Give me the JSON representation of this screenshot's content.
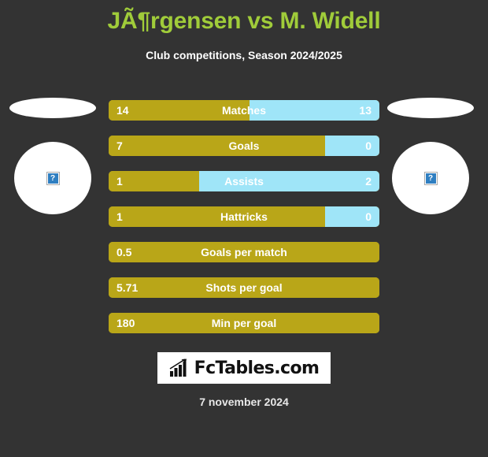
{
  "header": {
    "title": "JÃ¶rgensen vs M. Widell",
    "subtitle": "Club competitions, Season 2024/2025"
  },
  "players": {
    "left": {
      "avatar_icon": "broken-image-icon",
      "placeholder_glyph": "?"
    },
    "right": {
      "avatar_icon": "broken-image-icon",
      "placeholder_glyph": "?"
    }
  },
  "colors": {
    "background": "#333333",
    "title": "#a0cc3a",
    "home_bar": "#b9a618",
    "away_bar": "#9fe5f8",
    "text": "#ffffff"
  },
  "footer": {
    "logo_text": "FcTables.com",
    "logo_icon": "bar-chart-icon",
    "date": "7 november 2024"
  },
  "chart_data": {
    "type": "bar",
    "title": "JÃ¶rgensen vs M. Widell",
    "subtitle": "Club competitions, Season 2024/2025",
    "orientation": "horizontal-diverging",
    "series": [
      {
        "name": "JÃ¶rgensen",
        "color": "#b9a618"
      },
      {
        "name": "M. Widell",
        "color": "#9fe5f8"
      }
    ],
    "categories": [
      "Matches",
      "Goals",
      "Assists",
      "Hattricks",
      "Goals per match",
      "Shots per goal",
      "Min per goal"
    ],
    "rows": [
      {
        "label": "Matches",
        "left_value": "14",
        "right_value": "13",
        "left_pct": 51.9,
        "has_right": true
      },
      {
        "label": "Goals",
        "left_value": "7",
        "right_value": "0",
        "left_pct": 80.0,
        "has_right": true
      },
      {
        "label": "Assists",
        "left_value": "1",
        "right_value": "2",
        "left_pct": 33.3,
        "has_right": true
      },
      {
        "label": "Hattricks",
        "left_value": "1",
        "right_value": "0",
        "left_pct": 80.0,
        "has_right": true
      },
      {
        "label": "Goals per match",
        "left_value": "0.5",
        "right_value": "",
        "left_pct": 100.0,
        "has_right": false
      },
      {
        "label": "Shots per goal",
        "left_value": "5.71",
        "right_value": "",
        "left_pct": 100.0,
        "has_right": false
      },
      {
        "label": "Min per goal",
        "left_value": "180",
        "right_value": "",
        "left_pct": 100.0,
        "has_right": false
      }
    ]
  }
}
